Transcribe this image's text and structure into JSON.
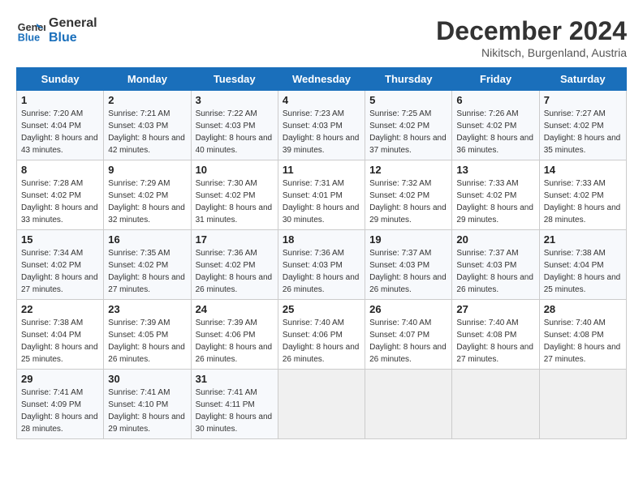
{
  "header": {
    "logo_line1": "General",
    "logo_line2": "Blue",
    "month": "December 2024",
    "location": "Nikitsch, Burgenland, Austria"
  },
  "columns": [
    "Sunday",
    "Monday",
    "Tuesday",
    "Wednesday",
    "Thursday",
    "Friday",
    "Saturday"
  ],
  "rows": [
    [
      {
        "day": "1",
        "sunrise": "Sunrise: 7:20 AM",
        "sunset": "Sunset: 4:04 PM",
        "daylight": "Daylight: 8 hours and 43 minutes."
      },
      {
        "day": "2",
        "sunrise": "Sunrise: 7:21 AM",
        "sunset": "Sunset: 4:03 PM",
        "daylight": "Daylight: 8 hours and 42 minutes."
      },
      {
        "day": "3",
        "sunrise": "Sunrise: 7:22 AM",
        "sunset": "Sunset: 4:03 PM",
        "daylight": "Daylight: 8 hours and 40 minutes."
      },
      {
        "day": "4",
        "sunrise": "Sunrise: 7:23 AM",
        "sunset": "Sunset: 4:03 PM",
        "daylight": "Daylight: 8 hours and 39 minutes."
      },
      {
        "day": "5",
        "sunrise": "Sunrise: 7:25 AM",
        "sunset": "Sunset: 4:02 PM",
        "daylight": "Daylight: 8 hours and 37 minutes."
      },
      {
        "day": "6",
        "sunrise": "Sunrise: 7:26 AM",
        "sunset": "Sunset: 4:02 PM",
        "daylight": "Daylight: 8 hours and 36 minutes."
      },
      {
        "day": "7",
        "sunrise": "Sunrise: 7:27 AM",
        "sunset": "Sunset: 4:02 PM",
        "daylight": "Daylight: 8 hours and 35 minutes."
      }
    ],
    [
      {
        "day": "8",
        "sunrise": "Sunrise: 7:28 AM",
        "sunset": "Sunset: 4:02 PM",
        "daylight": "Daylight: 8 hours and 33 minutes."
      },
      {
        "day": "9",
        "sunrise": "Sunrise: 7:29 AM",
        "sunset": "Sunset: 4:02 PM",
        "daylight": "Daylight: 8 hours and 32 minutes."
      },
      {
        "day": "10",
        "sunrise": "Sunrise: 7:30 AM",
        "sunset": "Sunset: 4:02 PM",
        "daylight": "Daylight: 8 hours and 31 minutes."
      },
      {
        "day": "11",
        "sunrise": "Sunrise: 7:31 AM",
        "sunset": "Sunset: 4:01 PM",
        "daylight": "Daylight: 8 hours and 30 minutes."
      },
      {
        "day": "12",
        "sunrise": "Sunrise: 7:32 AM",
        "sunset": "Sunset: 4:02 PM",
        "daylight": "Daylight: 8 hours and 29 minutes."
      },
      {
        "day": "13",
        "sunrise": "Sunrise: 7:33 AM",
        "sunset": "Sunset: 4:02 PM",
        "daylight": "Daylight: 8 hours and 29 minutes."
      },
      {
        "day": "14",
        "sunrise": "Sunrise: 7:33 AM",
        "sunset": "Sunset: 4:02 PM",
        "daylight": "Daylight: 8 hours and 28 minutes."
      }
    ],
    [
      {
        "day": "15",
        "sunrise": "Sunrise: 7:34 AM",
        "sunset": "Sunset: 4:02 PM",
        "daylight": "Daylight: 8 hours and 27 minutes."
      },
      {
        "day": "16",
        "sunrise": "Sunrise: 7:35 AM",
        "sunset": "Sunset: 4:02 PM",
        "daylight": "Daylight: 8 hours and 27 minutes."
      },
      {
        "day": "17",
        "sunrise": "Sunrise: 7:36 AM",
        "sunset": "Sunset: 4:02 PM",
        "daylight": "Daylight: 8 hours and 26 minutes."
      },
      {
        "day": "18",
        "sunrise": "Sunrise: 7:36 AM",
        "sunset": "Sunset: 4:03 PM",
        "daylight": "Daylight: 8 hours and 26 minutes."
      },
      {
        "day": "19",
        "sunrise": "Sunrise: 7:37 AM",
        "sunset": "Sunset: 4:03 PM",
        "daylight": "Daylight: 8 hours and 26 minutes."
      },
      {
        "day": "20",
        "sunrise": "Sunrise: 7:37 AM",
        "sunset": "Sunset: 4:03 PM",
        "daylight": "Daylight: 8 hours and 26 minutes."
      },
      {
        "day": "21",
        "sunrise": "Sunrise: 7:38 AM",
        "sunset": "Sunset: 4:04 PM",
        "daylight": "Daylight: 8 hours and 25 minutes."
      }
    ],
    [
      {
        "day": "22",
        "sunrise": "Sunrise: 7:38 AM",
        "sunset": "Sunset: 4:04 PM",
        "daylight": "Daylight: 8 hours and 25 minutes."
      },
      {
        "day": "23",
        "sunrise": "Sunrise: 7:39 AM",
        "sunset": "Sunset: 4:05 PM",
        "daylight": "Daylight: 8 hours and 26 minutes."
      },
      {
        "day": "24",
        "sunrise": "Sunrise: 7:39 AM",
        "sunset": "Sunset: 4:06 PM",
        "daylight": "Daylight: 8 hours and 26 minutes."
      },
      {
        "day": "25",
        "sunrise": "Sunrise: 7:40 AM",
        "sunset": "Sunset: 4:06 PM",
        "daylight": "Daylight: 8 hours and 26 minutes."
      },
      {
        "day": "26",
        "sunrise": "Sunrise: 7:40 AM",
        "sunset": "Sunset: 4:07 PM",
        "daylight": "Daylight: 8 hours and 26 minutes."
      },
      {
        "day": "27",
        "sunrise": "Sunrise: 7:40 AM",
        "sunset": "Sunset: 4:08 PM",
        "daylight": "Daylight: 8 hours and 27 minutes."
      },
      {
        "day": "28",
        "sunrise": "Sunrise: 7:40 AM",
        "sunset": "Sunset: 4:08 PM",
        "daylight": "Daylight: 8 hours and 27 minutes."
      }
    ],
    [
      {
        "day": "29",
        "sunrise": "Sunrise: 7:41 AM",
        "sunset": "Sunset: 4:09 PM",
        "daylight": "Daylight: 8 hours and 28 minutes."
      },
      {
        "day": "30",
        "sunrise": "Sunrise: 7:41 AM",
        "sunset": "Sunset: 4:10 PM",
        "daylight": "Daylight: 8 hours and 29 minutes."
      },
      {
        "day": "31",
        "sunrise": "Sunrise: 7:41 AM",
        "sunset": "Sunset: 4:11 PM",
        "daylight": "Daylight: 8 hours and 30 minutes."
      },
      null,
      null,
      null,
      null
    ]
  ]
}
